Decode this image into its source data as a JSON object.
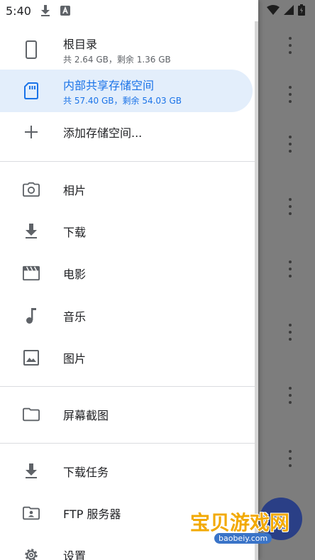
{
  "status_bar": {
    "time": "5:40"
  },
  "drawer": {
    "storage": [
      {
        "label": "根目录",
        "sub": "共 2.64 GB，剩余 1.36 GB",
        "icon": "phone-icon"
      },
      {
        "label": "内部共享存储空间",
        "sub": "共 57.40 GB，剩余 54.03 GB",
        "icon": "sd-card-icon",
        "active": true
      },
      {
        "label": "添加存储空间...",
        "icon": "plus-icon"
      }
    ],
    "media": [
      {
        "label": "相片",
        "icon": "camera-icon"
      },
      {
        "label": "下载",
        "icon": "download-icon"
      },
      {
        "label": "电影",
        "icon": "movie-icon"
      },
      {
        "label": "音乐",
        "icon": "music-note-icon"
      },
      {
        "label": "图片",
        "icon": "image-icon"
      }
    ],
    "screenshots": {
      "label": "屏幕截图",
      "icon": "folder-icon"
    },
    "tools": [
      {
        "label": "下载任务",
        "icon": "download-icon"
      },
      {
        "label": "FTP 服务器",
        "icon": "ftp-folder-icon"
      },
      {
        "label": "设置",
        "icon": "gear-icon"
      }
    ]
  },
  "watermark": {
    "text": "宝贝游戏网",
    "url": "baobeiy.com"
  },
  "colors": {
    "accent": "#1a73e8",
    "active_bg": "#e3eefb",
    "scrim": "#7d7d7d"
  }
}
